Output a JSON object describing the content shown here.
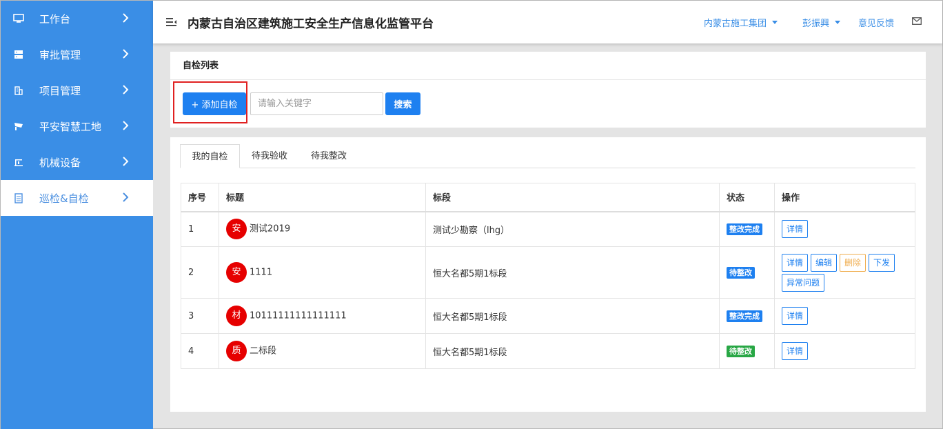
{
  "sidebar": {
    "items": [
      {
        "label": "工作台",
        "icon": "monitor-icon"
      },
      {
        "label": "审批管理",
        "icon": "server-icon"
      },
      {
        "label": "项目管理",
        "icon": "building-icon"
      },
      {
        "label": "平安智慧工地",
        "icon": "camera-icon"
      },
      {
        "label": "机械设备",
        "icon": "crane-icon"
      },
      {
        "label": "巡检&自检",
        "icon": "clipboard-icon",
        "active": true
      }
    ]
  },
  "header": {
    "title": "内蒙古自治区建筑施工安全生产信息化监管平台",
    "org": "内蒙古施工集团",
    "user": "彭振興",
    "feedback": "意见反馈"
  },
  "toolbar": {
    "section_title": "自检列表",
    "add_label": "+ 添加自检",
    "search_placeholder": "请输入关键字",
    "search_label": "搜索"
  },
  "tabs": [
    "我的自检",
    "待我验收",
    "待我整改"
  ],
  "table": {
    "headers": [
      "序号",
      "标题",
      "标段",
      "状态",
      "操作"
    ],
    "rows": [
      {
        "no": "1",
        "badge": "安",
        "title": "测试2019",
        "section": "测试少勘察（lhg）",
        "status": "整改完成",
        "status_color": "#1e80f0",
        "ops": [
          "详情"
        ]
      },
      {
        "no": "2",
        "badge": "安",
        "title": "1111",
        "section": "恒大名都5期1标段",
        "status": "待整改",
        "status_color": "#1e80f0",
        "ops": [
          "详情",
          "编辑",
          "删除",
          "下发",
          "异常问题"
        ]
      },
      {
        "no": "3",
        "badge": "材",
        "title": "10111111111111111",
        "section": "恒大名都5期1标段",
        "status": "整改完成",
        "status_color": "#1e80f0",
        "ops": [
          "详情"
        ]
      },
      {
        "no": "4",
        "badge": "质",
        "title": "二标段",
        "section": "恒大名都5期1标段",
        "status": "待整改",
        "status_color": "#28a745",
        "ops": [
          "详情"
        ]
      }
    ]
  }
}
